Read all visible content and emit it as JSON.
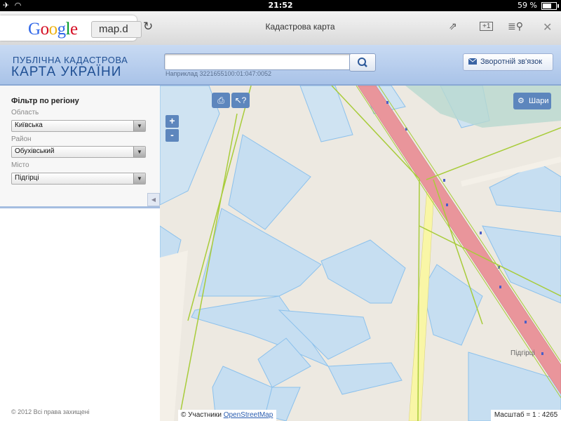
{
  "status_bar": {
    "time": "21:52",
    "battery": "59 %",
    "battery_level": 0.59
  },
  "browser": {
    "google_logo": "Google",
    "url": "map.d",
    "page_title": "Кадастрова карта",
    "tab_count": "1"
  },
  "header": {
    "logo_line1": "ПУБЛІЧНА КАДАСТРОВА",
    "logo_line2": "КАРТА УКРАЇНИ",
    "search": {
      "value": "",
      "hint": "Наприклад 3221655100:01:047:0052"
    },
    "feedback_label": "Зворотній зв'язок"
  },
  "sidebar": {
    "filter_title": "Фільтр по регіону",
    "fields": [
      {
        "label": "Область",
        "value": "Київська"
      },
      {
        "label": "Район",
        "value": "Обухівський"
      },
      {
        "label": "Місто",
        "value": "Підгірці"
      }
    ],
    "copyright": "© 2012 Всі права захищені"
  },
  "map": {
    "zoom_in": "+",
    "zoom_out": "-",
    "layers_label": "Шари",
    "attribution_prefix": "© Участники",
    "attribution_link": "OpenStreetMap",
    "scale_label": "Масштаб = 1 : 4265",
    "place_label": "Підгірці",
    "colors": {
      "background": "#ede9e1",
      "parcel_fill": "#c6def1",
      "parcel_stroke": "#8cc1ec",
      "boundary": "#a8cc3a",
      "highway": "#e9959b",
      "road": "#f9f6a6",
      "button": "#5d86bd"
    }
  }
}
